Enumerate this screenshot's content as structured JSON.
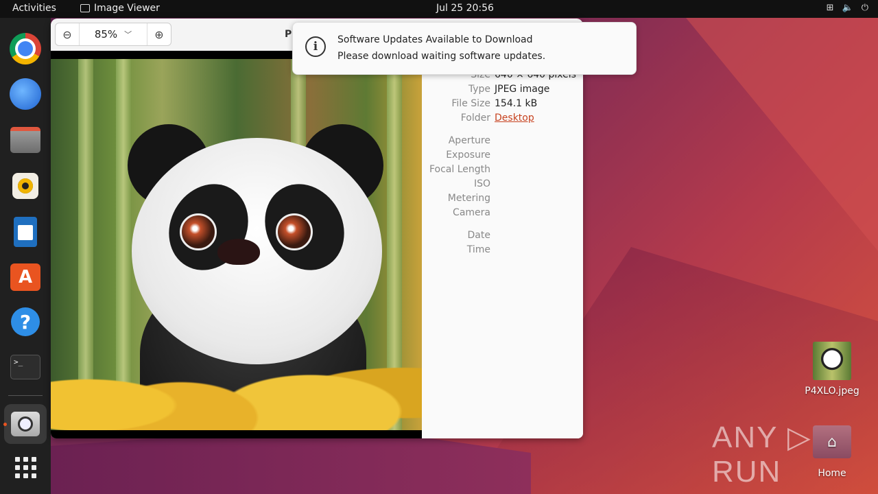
{
  "topbar": {
    "activities": "Activities",
    "app_name": "Image Viewer",
    "clock": "Jul 25  20:56",
    "tray_icons": [
      "network-icon",
      "volume-icon",
      "power-icon"
    ]
  },
  "dock": {
    "apps": [
      "Google Chrome",
      "Thunderbird Mail",
      "Files",
      "Rhythmbox",
      "LibreOffice Writer",
      "Ubuntu Software",
      "Help",
      "Terminal",
      "Image Viewer",
      "Show Applications"
    ],
    "terminal_glyph": ">_"
  },
  "viewer": {
    "zoom": "85%",
    "title": "P",
    "properties": [
      {
        "key": "Size",
        "value": "640 × 640 pixels"
      },
      {
        "key": "Type",
        "value": "JPEG image"
      },
      {
        "key": "File Size",
        "value": "154.1 kB"
      },
      {
        "key": "Folder",
        "value": "Desktop"
      },
      {
        "key": "Aperture",
        "value": ""
      },
      {
        "key": "Exposure",
        "value": ""
      },
      {
        "key": "Focal Length",
        "value": ""
      },
      {
        "key": "ISO",
        "value": ""
      },
      {
        "key": "Metering",
        "value": ""
      },
      {
        "key": "Camera",
        "value": ""
      },
      {
        "key": "Date",
        "value": ""
      },
      {
        "key": "Time",
        "value": ""
      }
    ]
  },
  "notification": {
    "title": "Software Updates Available to Download",
    "body": "Please download waiting software updates."
  },
  "desktop": {
    "file_label": "P4XLO.jpeg",
    "home_label": "Home"
  },
  "watermark": "ANY ▷ RUN",
  "colors": {
    "accent": "#e95420",
    "link": "#c7421f"
  }
}
